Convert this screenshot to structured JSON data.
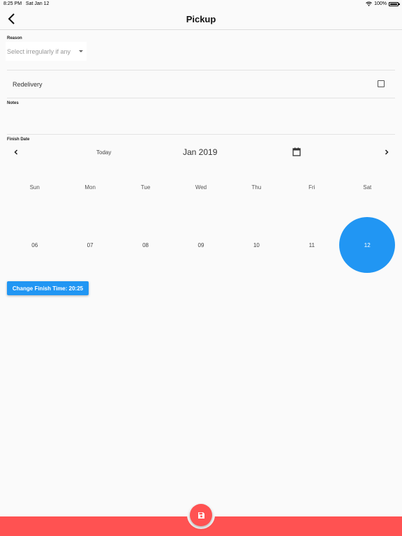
{
  "status_bar": {
    "time": "8:25 PM",
    "date": "Sat Jan 12",
    "battery": "100%"
  },
  "app_bar": {
    "title": "Pickup"
  },
  "form": {
    "reason_label": "Reason",
    "reason_placeholder": "Select irregularly if any",
    "redelivery_label": "Redelivery",
    "redelivery_checked": false,
    "notes_label": "Notes",
    "notes_value": "",
    "finish_date_label": "Finish Date"
  },
  "calendar": {
    "today_label": "Today",
    "month_label": "Jan 2019",
    "weekdays": [
      "Sun",
      "Mon",
      "Tue",
      "Wed",
      "Thu",
      "Fri",
      "Sat"
    ],
    "days": [
      "06",
      "07",
      "08",
      "09",
      "10",
      "11",
      "12"
    ],
    "selected_day": "12",
    "accent_color": "#2196f3"
  },
  "finish_time_button": "Change Finish Time: 20:25",
  "bottom": {
    "bar_color": "#ff5252",
    "fab_icon": "save-icon"
  }
}
